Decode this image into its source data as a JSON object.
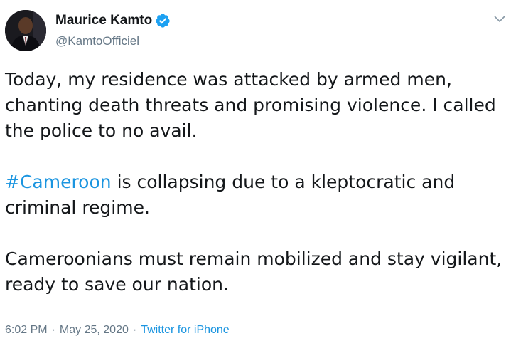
{
  "author": {
    "name": "Maurice Kamto",
    "handle": "@KamtoOfficiel",
    "verified": true,
    "avatar_icon": "profile-photo"
  },
  "menu_icon": "chevron-down-icon",
  "tweet": {
    "paragraph1": "Today, my residence was attacked by armed men, chanting death threats and promising violence. I called the police to no avail.",
    "hashtag": "#Cameroon",
    "paragraph2_rest": " is collapsing due to a kleptocratic and criminal regime.",
    "paragraph3": "Cameroonians must remain mobilized and stay vigilant, ready to save our nation."
  },
  "meta": {
    "time": "6:02 PM",
    "separator": "·",
    "date": "May 25, 2020",
    "source": "Twitter for iPhone"
  },
  "colors": {
    "link": "#1b95e0",
    "verified_badge": "#1da1f2",
    "secondary_text": "#657786",
    "primary_text": "#14171a"
  }
}
